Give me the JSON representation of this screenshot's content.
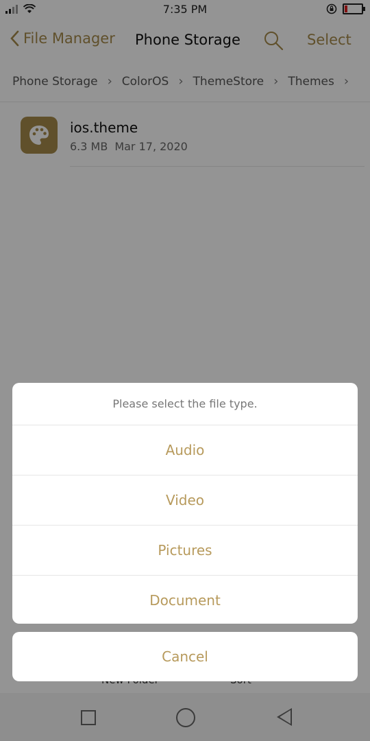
{
  "status_bar": {
    "time": "7:35 PM"
  },
  "header": {
    "back_label": "File Manager",
    "title": "Phone Storage",
    "select_label": "Select"
  },
  "breadcrumb": [
    "Phone Storage",
    "ColorOS",
    "ThemeStore",
    "Themes"
  ],
  "files": [
    {
      "name": "ios.theme",
      "size": "6.3 MB",
      "date": "Mar 17, 2020",
      "icon": "palette-icon"
    }
  ],
  "toolbar": {
    "new_folder": "New Folder",
    "sort": "Sort"
  },
  "dialog": {
    "title": "Please select the file type.",
    "options": [
      "Audio",
      "Video",
      "Pictures",
      "Document"
    ],
    "cancel": "Cancel"
  },
  "colors": {
    "accent": "#a58a4b",
    "battery_low": "#e02020"
  }
}
